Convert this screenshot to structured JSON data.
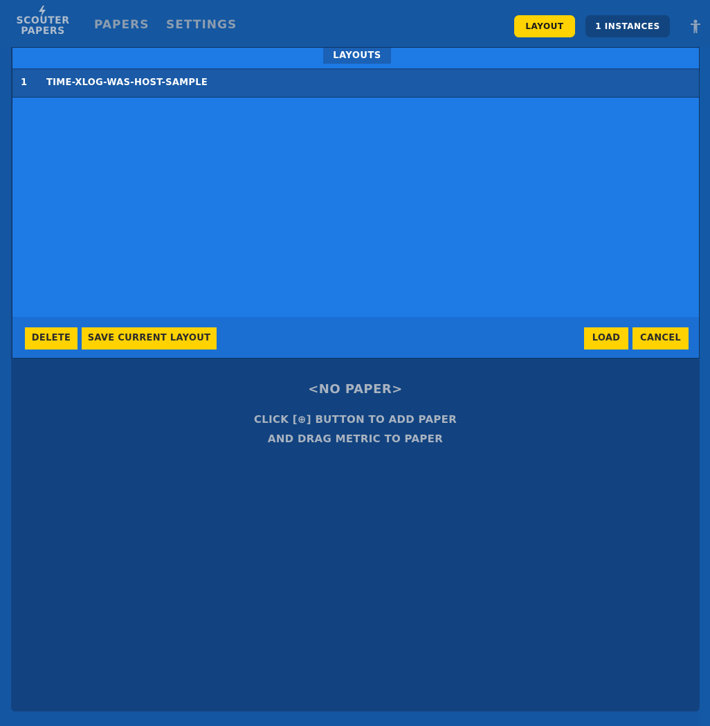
{
  "header": {
    "logo_line1": "SCOUTER",
    "logo_line2": "PAPERS",
    "nav": {
      "papers": "PAPERS",
      "settings": "SETTINGS"
    },
    "layout_button": "LAYOUT",
    "instances_button": "1 INSTANCES",
    "icons": {
      "logo": "lightning-bolt-icon",
      "user": "user-icon"
    }
  },
  "layouts_dialog": {
    "title": "LAYOUTS",
    "items": [
      {
        "no": "1",
        "name": "TIME-XLOG-WAS-HOST-SAMPLE"
      }
    ],
    "buttons": {
      "delete": "DELETE",
      "save_current": "SAVE CURRENT LAYOUT",
      "load": "LOAD",
      "cancel": "CANCEL"
    }
  },
  "empty_state": {
    "title": "<NO PAPER>",
    "line1": "CLICK [⊕] BUTTON TO ADD PAPER",
    "line2": "AND DRAG METRIC TO PAPER"
  },
  "colors": {
    "background": "#1556a3",
    "accent_yellow": "#ffd200",
    "dialog_blue": "#1e7ae4",
    "main_dark": "#124380"
  }
}
